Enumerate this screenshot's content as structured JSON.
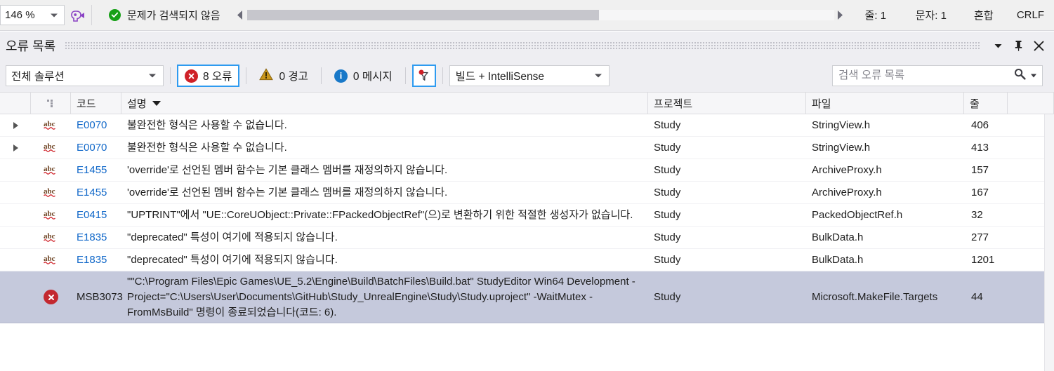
{
  "status_bar": {
    "zoom_level": "146 %",
    "intellicode_icon": "intellicode-icon",
    "status_message": "문제가 검색되지 않음",
    "status_icon": "check-circle-icon",
    "scroll_left_icon": "scroll-left-arrow-icon",
    "scroll_right_icon": "scroll-right-arrow-icon",
    "line": "줄: 1",
    "column": "문자: 1",
    "insert_mode": "혼합",
    "line_ending": "CRLF"
  },
  "panel": {
    "title": "오류 목록",
    "window_menu_icon": "chevron-down-icon",
    "pin_icon": "pin-icon",
    "close_icon": "close-icon"
  },
  "toolbar": {
    "scope": {
      "value": "전체 솔루션",
      "caret_icon": "chevron-down-icon"
    },
    "errors": {
      "label": "8 오류",
      "count": "8",
      "icon": "error-circle-icon",
      "active": true
    },
    "warnings": {
      "label": "0 경고",
      "count": "0",
      "icon": "warning-triangle-icon",
      "active": false
    },
    "messages": {
      "label": "0 메시지",
      "count": "0",
      "icon": "info-circle-icon",
      "active": false
    },
    "filter": {
      "icon": "filter-funnel-icon",
      "active": true
    },
    "source": {
      "value": "빌드 + IntelliSense",
      "caret_icon": "chevron-down-icon"
    },
    "search": {
      "placeholder": "검색 오류 목록",
      "value": "",
      "icon": "search-magnifier-icon",
      "caret_icon": "chevron-down-icon"
    }
  },
  "grid": {
    "columns": [
      {
        "key": "expander",
        "label": ""
      },
      {
        "key": "icon",
        "label": ""
      },
      {
        "key": "code",
        "label": "코드"
      },
      {
        "key": "description",
        "label": "설명",
        "sorted": "desc",
        "sort_icon": "sort-descending-icon"
      },
      {
        "key": "project",
        "label": "프로젝트"
      },
      {
        "key": "file",
        "label": "파일"
      },
      {
        "key": "line",
        "label": "줄"
      }
    ],
    "rows": [
      {
        "expandable": true,
        "expander_icon": "expand-triangle-icon",
        "severity_icon": "intellisense-abc-icon",
        "code": "E0070",
        "description": "불완전한 형식은 사용할 수 없습니다.",
        "project": "Study",
        "file": "StringView.h",
        "line": "406",
        "selected": false
      },
      {
        "expandable": true,
        "expander_icon": "expand-triangle-icon",
        "severity_icon": "intellisense-abc-icon",
        "code": "E0070",
        "description": "불완전한 형식은 사용할 수 없습니다.",
        "project": "Study",
        "file": "StringView.h",
        "line": "413",
        "selected": false
      },
      {
        "expandable": false,
        "expander_icon": "",
        "severity_icon": "intellisense-abc-icon",
        "code": "E1455",
        "description": "'override'로 선언된 멤버 함수는 기본 클래스 멤버를 재정의하지 않습니다.",
        "project": "Study",
        "file": "ArchiveProxy.h",
        "line": "157",
        "selected": false
      },
      {
        "expandable": false,
        "expander_icon": "",
        "severity_icon": "intellisense-abc-icon",
        "code": "E1455",
        "description": "'override'로 선언된 멤버 함수는 기본 클래스 멤버를 재정의하지 않습니다.",
        "project": "Study",
        "file": "ArchiveProxy.h",
        "line": "167",
        "selected": false
      },
      {
        "expandable": false,
        "expander_icon": "",
        "severity_icon": "intellisense-abc-icon",
        "code": "E0415",
        "description": "\"UPTRINT\"에서 \"UE::CoreUObject::Private::FPackedObjectRef\"(으)로 변환하기 위한 적절한 생성자가 없습니다.",
        "project": "Study",
        "file": "PackedObjectRef.h",
        "line": "32",
        "selected": false
      },
      {
        "expandable": false,
        "expander_icon": "",
        "severity_icon": "intellisense-abc-icon",
        "code": "E1835",
        "description": "\"deprecated\" 특성이 여기에 적용되지 않습니다.",
        "project": "Study",
        "file": "BulkData.h",
        "line": "277",
        "selected": false
      },
      {
        "expandable": false,
        "expander_icon": "",
        "severity_icon": "intellisense-abc-icon",
        "code": "E1835",
        "description": "\"deprecated\" 특성이 여기에 적용되지 않습니다.",
        "project": "Study",
        "file": "BulkData.h",
        "line": "1201",
        "selected": false
      },
      {
        "expandable": false,
        "expander_icon": "",
        "severity_icon": "error-circle-icon",
        "code": "MSB3073",
        "description": "\"\"C:\\Program Files\\Epic Games\\UE_5.2\\Engine\\Build\\BatchFiles\\Build.bat\" StudyEditor Win64 Development -Project=\"C:\\Users\\User\\Documents\\GitHub\\Study_UnrealEngine\\Study\\Study.uproject\" -WaitMutex -FromMsBuild\" 명령이 종료되었습니다(코드: 6).",
        "project": "Study",
        "file": "Microsoft.MakeFile.Targets",
        "line": "44",
        "selected": true
      }
    ]
  },
  "colors": {
    "accent_blue": "#2e9bf0",
    "error_red": "#cf2128",
    "warning_amber": "#bf8f00",
    "info_blue": "#1878c8",
    "success_green": "#17a017",
    "code_link": "#1168c9",
    "selection": "#c5c9dc",
    "toolbar_bg": "#eeeef2"
  }
}
